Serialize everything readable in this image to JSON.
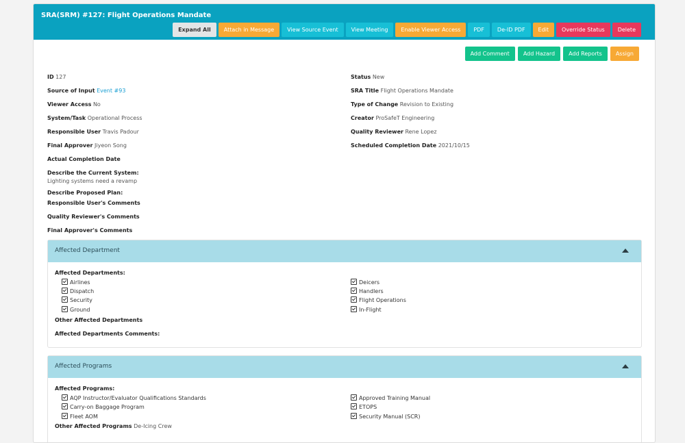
{
  "header": {
    "title": "SRA(SRM) #127: Flight Operations Mandate",
    "buttons": {
      "expand_all": "Expand All",
      "attach_in_message": "Attach in Message",
      "view_source_event": "View Source Event",
      "view_meeting": "View Meeting",
      "enable_viewer_access": "Enable Viewer Access",
      "pdf": "PDF",
      "deid_pdf": "De-ID PDF",
      "edit": "Edit",
      "override_status": "Override Status",
      "delete": "Delete"
    }
  },
  "actions": {
    "add_comment": "Add Comment",
    "add_hazard": "Add Hazard",
    "add_reports": "Add Reports",
    "assign": "Assign"
  },
  "fields": {
    "id": {
      "label": "ID",
      "value": "127"
    },
    "source": {
      "label": "Source of Input",
      "value": "Event #93"
    },
    "viewer_access": {
      "label": "Viewer Access",
      "value": "No"
    },
    "system_task": {
      "label": "System/Task",
      "value": "Operational Process"
    },
    "responsible_user": {
      "label": "Responsible User",
      "value": "Travis Padour"
    },
    "final_approver": {
      "label": "Final Approver",
      "value": "Jiyeon Song"
    },
    "actual_completion": {
      "label": "Actual Completion Date",
      "value": ""
    },
    "current_system": {
      "label": "Describe the Current System:",
      "value": "Lighting systems need a revamp"
    },
    "proposed_plan": {
      "label": "Describe Proposed Plan:",
      "value": ""
    },
    "resp_user_comments": {
      "label": "Responsible User's Comments",
      "value": ""
    },
    "quality_reviewer_comments": {
      "label": "Quality Reviewer's Comments",
      "value": ""
    },
    "final_approver_comments": {
      "label": "Final Approver's Comments",
      "value": ""
    },
    "status": {
      "label": "Status",
      "value": "New"
    },
    "sra_title": {
      "label": "SRA Title",
      "value": "Flight Operations Mandate"
    },
    "type_of_change": {
      "label": "Type of Change",
      "value": "Revision to Existing"
    },
    "creator": {
      "label": "Creator",
      "value": "ProSafeT Engineering"
    },
    "quality_reviewer": {
      "label": "Quality Reviewer",
      "value": "Rene Lopez"
    },
    "scheduled_completion": {
      "label": "Scheduled Completion Date",
      "value": "2021/10/15"
    }
  },
  "affected_department": {
    "title": "Affected Department",
    "list_label": "Affected Departments:",
    "left": [
      "Airlines",
      "Dispatch",
      "Security",
      "Ground"
    ],
    "right": [
      "Deicers",
      "Handlers",
      "Flight Operations",
      "In-Flight"
    ],
    "other_label": "Other Affected Departments",
    "comments_label": "Affected Departments Comments:"
  },
  "affected_programs": {
    "title": "Affected Programs",
    "list_label": "Affected Programs:",
    "left": [
      "AQP Instructor/Evaluator Qualifications Standards",
      "Carry-on Baggage Program",
      "Fleet AOM"
    ],
    "right": [
      "Approved Training Manual",
      "ETOPS",
      "Security Manual (SCR)"
    ],
    "other_label": "Other Affected Programs",
    "other_value": "De-Icing Crew"
  }
}
